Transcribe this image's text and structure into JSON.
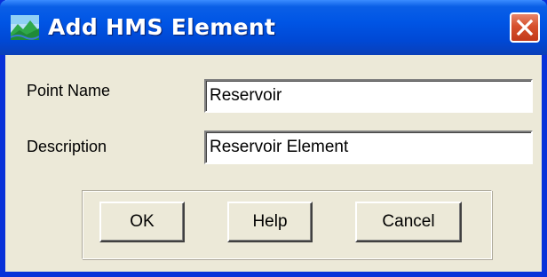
{
  "window": {
    "title": "Add HMS Element",
    "app_icon": "hms-landscape-icon",
    "close_icon": "close-icon"
  },
  "form": {
    "point_name_label": "Point Name",
    "point_name_value": "Reservoir",
    "description_label": "Description",
    "description_value": "Reservoir Element"
  },
  "buttons": {
    "ok_label": "OK",
    "help_label": "Help",
    "cancel_label": "Cancel"
  },
  "colors": {
    "titlebar": "#0055e5",
    "frame": "#0831d9",
    "dialog_bg": "#ece9d8",
    "close_button": "#d6502c"
  }
}
